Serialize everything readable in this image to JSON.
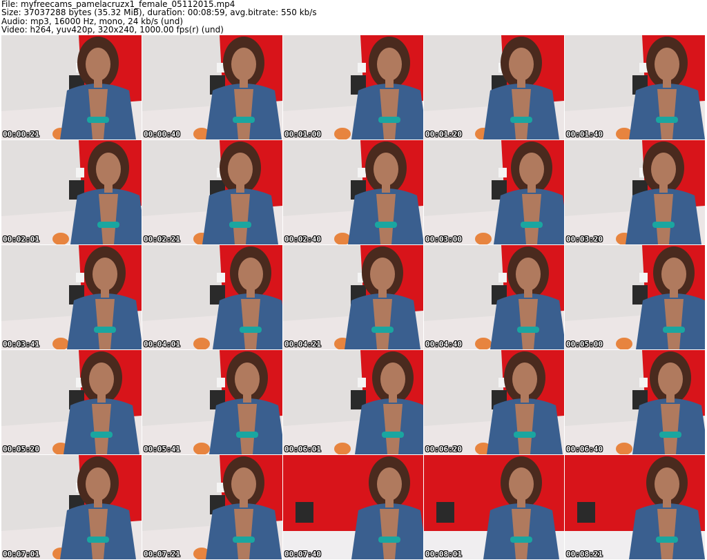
{
  "header": {
    "file_line": "File: myfreecams_pamelacruzx1_female_05112015.mp4",
    "size_line": "Size: 37037288 bytes (35.32 MiB), duration: 00:08:59, avg.bitrate: 550 kb/s",
    "audio_line": "Audio: mp3, 16000 Hz, mono, 24 kb/s (und)",
    "video_line": "Video: h264, yuv420p, 320x240, 1000.00 fps(r) (und)"
  },
  "thumbnails": [
    {
      "timestamp": "00:00:21"
    },
    {
      "timestamp": "00:00:40"
    },
    {
      "timestamp": "00:01:00"
    },
    {
      "timestamp": "00:01:20"
    },
    {
      "timestamp": "00:01:40"
    },
    {
      "timestamp": "00:02:01"
    },
    {
      "timestamp": "00:02:21"
    },
    {
      "timestamp": "00:02:40"
    },
    {
      "timestamp": "00:03:00"
    },
    {
      "timestamp": "00:03:20"
    },
    {
      "timestamp": "00:03:41"
    },
    {
      "timestamp": "00:04:01"
    },
    {
      "timestamp": "00:04:21"
    },
    {
      "timestamp": "00:04:40"
    },
    {
      "timestamp": "00:05:00"
    },
    {
      "timestamp": "00:05:20"
    },
    {
      "timestamp": "00:05:41"
    },
    {
      "timestamp": "00:06:01"
    },
    {
      "timestamp": "00:06:20"
    },
    {
      "timestamp": "00:06:40"
    },
    {
      "timestamp": "00:07:01"
    },
    {
      "timestamp": "00:07:21"
    },
    {
      "timestamp": "00:07:40"
    },
    {
      "timestamp": "00:08:01"
    },
    {
      "timestamp": "00:08:21"
    }
  ],
  "colors": {
    "wall": "#e6e2e0",
    "red_wall": "#d8141a",
    "denim": "#3a5f8f",
    "skin": "#b07a5e",
    "hair": "#4a2a1e",
    "teal": "#1aa6a0",
    "floor": "#ece6e6",
    "ball": "#e7843f"
  }
}
